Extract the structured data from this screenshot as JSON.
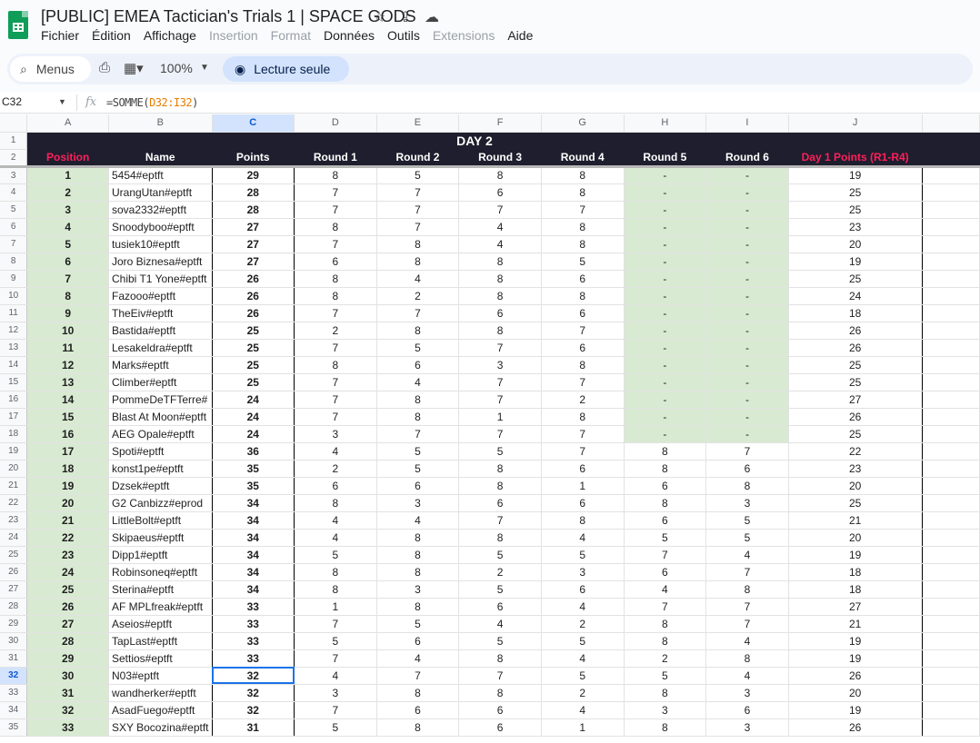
{
  "app": {
    "title": "[PUBLIC] EMEA Tactician's Trials 1 | SPACE GODS",
    "menu": [
      {
        "label": "Fichier",
        "disabled": false
      },
      {
        "label": "Édition",
        "disabled": false
      },
      {
        "label": "Affichage",
        "disabled": false
      },
      {
        "label": "Insertion",
        "disabled": true
      },
      {
        "label": "Format",
        "disabled": true
      },
      {
        "label": "Données",
        "disabled": false
      },
      {
        "label": "Outils",
        "disabled": false
      },
      {
        "label": "Extensions",
        "disabled": true
      },
      {
        "label": "Aide",
        "disabled": false
      }
    ],
    "title_icons": [
      "star-icon",
      "move-to-drive-icon",
      "cloud-status-icon"
    ]
  },
  "toolbar": {
    "menus_label": "Menus",
    "zoom": "100%",
    "readonly_label": "Lecture seule"
  },
  "formula_bar": {
    "cell_ref": "C32",
    "fx": "fx",
    "formula_prefix": "=SOMME(",
    "formula_range": "D32:I32",
    "formula_suffix": ")"
  },
  "columns": [
    "A",
    "B",
    "C",
    "D",
    "E",
    "F",
    "G",
    "H",
    "I",
    "J"
  ],
  "selected_column": "C",
  "selected_row": 32,
  "sheet": {
    "day_title": "DAY 2",
    "headers": [
      "Position",
      "Name",
      "Points",
      "Round 1",
      "Round 2",
      "Round 3",
      "Round 4",
      "Round 5",
      "Round 6",
      "Day 1 Points (R1-R4)"
    ],
    "rows": [
      {
        "row": 3,
        "pos": "1",
        "name": "5454#eptft",
        "pts": "29",
        "r1": "8",
        "r2": "5",
        "r3": "8",
        "r4": "8",
        "r5": "-",
        "r6": "-",
        "d1": "19"
      },
      {
        "row": 4,
        "pos": "2",
        "name": "UrangUtan#eptft",
        "pts": "28",
        "r1": "7",
        "r2": "7",
        "r3": "6",
        "r4": "8",
        "r5": "-",
        "r6": "-",
        "d1": "25"
      },
      {
        "row": 5,
        "pos": "3",
        "name": "sova2332#eptft",
        "pts": "28",
        "r1": "7",
        "r2": "7",
        "r3": "7",
        "r4": "7",
        "r5": "-",
        "r6": "-",
        "d1": "25"
      },
      {
        "row": 6,
        "pos": "4",
        "name": "Snoodyboo#eptft",
        "pts": "27",
        "r1": "8",
        "r2": "7",
        "r3": "4",
        "r4": "8",
        "r5": "-",
        "r6": "-",
        "d1": "23"
      },
      {
        "row": 7,
        "pos": "5",
        "name": "tusiek10#eptft",
        "pts": "27",
        "r1": "7",
        "r2": "8",
        "r3": "4",
        "r4": "8",
        "r5": "-",
        "r6": "-",
        "d1": "20"
      },
      {
        "row": 8,
        "pos": "6",
        "name": "Joro Biznesa#eptft",
        "pts": "27",
        "r1": "6",
        "r2": "8",
        "r3": "8",
        "r4": "5",
        "r5": "-",
        "r6": "-",
        "d1": "19"
      },
      {
        "row": 9,
        "pos": "7",
        "name": "Chibi T1 Yone#eptft",
        "pts": "26",
        "r1": "8",
        "r2": "4",
        "r3": "8",
        "r4": "6",
        "r5": "-",
        "r6": "-",
        "d1": "25"
      },
      {
        "row": 10,
        "pos": "8",
        "name": "Fazooo#eptft",
        "pts": "26",
        "r1": "8",
        "r2": "2",
        "r3": "8",
        "r4": "8",
        "r5": "-",
        "r6": "-",
        "d1": "24"
      },
      {
        "row": 11,
        "pos": "9",
        "name": "TheEiv#eptft",
        "pts": "26",
        "r1": "7",
        "r2": "7",
        "r3": "6",
        "r4": "6",
        "r5": "-",
        "r6": "-",
        "d1": "18"
      },
      {
        "row": 12,
        "pos": "10",
        "name": "Bastida#eptft",
        "pts": "25",
        "r1": "2",
        "r2": "8",
        "r3": "8",
        "r4": "7",
        "r5": "-",
        "r6": "-",
        "d1": "26"
      },
      {
        "row": 13,
        "pos": "11",
        "name": "Lesakeldra#eptft",
        "pts": "25",
        "r1": "7",
        "r2": "5",
        "r3": "7",
        "r4": "6",
        "r5": "-",
        "r6": "-",
        "d1": "26"
      },
      {
        "row": 14,
        "pos": "12",
        "name": "Marks#eptft",
        "pts": "25",
        "r1": "8",
        "r2": "6",
        "r3": "3",
        "r4": "8",
        "r5": "-",
        "r6": "-",
        "d1": "25"
      },
      {
        "row": 15,
        "pos": "13",
        "name": "Climber#eptft",
        "pts": "25",
        "r1": "7",
        "r2": "4",
        "r3": "7",
        "r4": "7",
        "r5": "-",
        "r6": "-",
        "d1": "25"
      },
      {
        "row": 16,
        "pos": "14",
        "name": "PommeDeTFTerre#",
        "pts": "24",
        "r1": "7",
        "r2": "8",
        "r3": "7",
        "r4": "2",
        "r5": "-",
        "r6": "-",
        "d1": "27"
      },
      {
        "row": 17,
        "pos": "15",
        "name": "Blast At Moon#eptft",
        "pts": "24",
        "r1": "7",
        "r2": "8",
        "r3": "1",
        "r4": "8",
        "r5": "-",
        "r6": "-",
        "d1": "26"
      },
      {
        "row": 18,
        "pos": "16",
        "name": "AEG Opale#eptft",
        "pts": "24",
        "r1": "3",
        "r2": "7",
        "r3": "7",
        "r4": "7",
        "r5": "-",
        "r6": "-",
        "d1": "25"
      },
      {
        "row": 19,
        "pos": "17",
        "name": "Spoti#eptft",
        "pts": "36",
        "r1": "4",
        "r2": "5",
        "r3": "5",
        "r4": "7",
        "r5": "8",
        "r6": "7",
        "d1": "22"
      },
      {
        "row": 20,
        "pos": "18",
        "name": "konst1pe#eptft",
        "pts": "35",
        "r1": "2",
        "r2": "5",
        "r3": "8",
        "r4": "6",
        "r5": "8",
        "r6": "6",
        "d1": "23"
      },
      {
        "row": 21,
        "pos": "19",
        "name": "Dzsek#eptft",
        "pts": "35",
        "r1": "6",
        "r2": "6",
        "r3": "8",
        "r4": "1",
        "r5": "6",
        "r6": "8",
        "d1": "20"
      },
      {
        "row": 22,
        "pos": "20",
        "name": "G2 Canbizz#eprod",
        "pts": "34",
        "r1": "8",
        "r2": "3",
        "r3": "6",
        "r4": "6",
        "r5": "8",
        "r6": "3",
        "d1": "25"
      },
      {
        "row": 23,
        "pos": "21",
        "name": "LittleBolt#eptft",
        "pts": "34",
        "r1": "4",
        "r2": "4",
        "r3": "7",
        "r4": "8",
        "r5": "6",
        "r6": "5",
        "d1": "21"
      },
      {
        "row": 24,
        "pos": "22",
        "name": "Skipaeus#eptft",
        "pts": "34",
        "r1": "4",
        "r2": "8",
        "r3": "8",
        "r4": "4",
        "r5": "5",
        "r6": "5",
        "d1": "20"
      },
      {
        "row": 25,
        "pos": "23",
        "name": "Dipp1#eptft",
        "pts": "34",
        "r1": "5",
        "r2": "8",
        "r3": "5",
        "r4": "5",
        "r5": "7",
        "r6": "4",
        "d1": "19"
      },
      {
        "row": 26,
        "pos": "24",
        "name": "Robinsoneq#eptft",
        "pts": "34",
        "r1": "8",
        "r2": "8",
        "r3": "2",
        "r4": "3",
        "r5": "6",
        "r6": "7",
        "d1": "18"
      },
      {
        "row": 27,
        "pos": "25",
        "name": "Sterina#eptft",
        "pts": "34",
        "r1": "8",
        "r2": "3",
        "r3": "5",
        "r4": "6",
        "r5": "4",
        "r6": "8",
        "d1": "18"
      },
      {
        "row": 28,
        "pos": "26",
        "name": "AF MPLfreak#eptft",
        "pts": "33",
        "r1": "1",
        "r2": "8",
        "r3": "6",
        "r4": "4",
        "r5": "7",
        "r6": "7",
        "d1": "27"
      },
      {
        "row": 29,
        "pos": "27",
        "name": "Aseios#eptft",
        "pts": "33",
        "r1": "7",
        "r2": "5",
        "r3": "4",
        "r4": "2",
        "r5": "8",
        "r6": "7",
        "d1": "21"
      },
      {
        "row": 30,
        "pos": "28",
        "name": "TapLast#eptft",
        "pts": "33",
        "r1": "5",
        "r2": "6",
        "r3": "5",
        "r4": "5",
        "r5": "8",
        "r6": "4",
        "d1": "19"
      },
      {
        "row": 31,
        "pos": "29",
        "name": "Settios#eptft",
        "pts": "33",
        "r1": "7",
        "r2": "4",
        "r3": "8",
        "r4": "4",
        "r5": "2",
        "r6": "8",
        "d1": "19"
      },
      {
        "row": 32,
        "pos": "30",
        "name": "N03#eptft",
        "pts": "32",
        "r1": "4",
        "r2": "7",
        "r3": "7",
        "r4": "5",
        "r5": "5",
        "r6": "4",
        "d1": "26"
      },
      {
        "row": 33,
        "pos": "31",
        "name": "wandherker#eptft",
        "pts": "32",
        "r1": "3",
        "r2": "8",
        "r3": "8",
        "r4": "2",
        "r5": "8",
        "r6": "3",
        "d1": "20"
      },
      {
        "row": 34,
        "pos": "32",
        "name": "AsadFuego#eptft",
        "pts": "32",
        "r1": "7",
        "r2": "6",
        "r3": "6",
        "r4": "4",
        "r5": "3",
        "r6": "6",
        "d1": "19"
      },
      {
        "row": 35,
        "pos": "33",
        "name": "SXY Bocozina#eptft",
        "pts": "31",
        "r1": "5",
        "r2": "8",
        "r3": "6",
        "r4": "1",
        "r5": "8",
        "r6": "3",
        "d1": "26"
      }
    ]
  },
  "colors": {
    "header_bg": "#1e1e2e",
    "accent_pink": "#ff1f5a",
    "green_fill": "#d9ead3",
    "selection_blue": "#1a73e8"
  }
}
